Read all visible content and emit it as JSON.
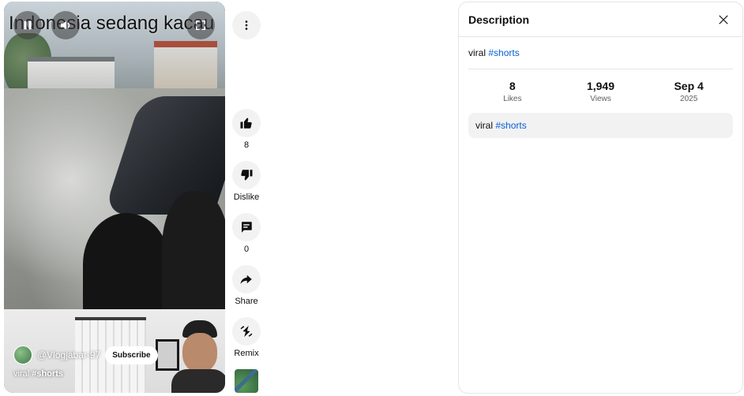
{
  "video": {
    "overlay_title": "Indonesia sedang kacau",
    "channel_name": "@Vlogjabar-97",
    "subscribe_label": "Subscribe",
    "caption_text": "viral",
    "caption_hashtag": "#shorts",
    "controls": [
      "pause-icon",
      "volume-icon",
      "fullscreen-icon"
    ]
  },
  "actions": {
    "more_icon": "more-vert-icon",
    "like": {
      "icon": "thumb-up-icon",
      "label": "8"
    },
    "dislike": {
      "icon": "thumb-down-icon",
      "label": "Dislike"
    },
    "comments": {
      "icon": "comment-icon",
      "label": "0"
    },
    "share": {
      "icon": "share-icon",
      "label": "Share"
    },
    "remix": {
      "icon": "remix-icon",
      "label": "Remix"
    }
  },
  "description_panel": {
    "title": "Description",
    "close_icon": "close-icon",
    "summary_text": "viral",
    "summary_hashtag": "#shorts",
    "stats": [
      {
        "value": "8",
        "label": "Likes"
      },
      {
        "value": "1,949",
        "label": "Views"
      },
      {
        "value": "Sep 4",
        "label": "2025"
      }
    ],
    "full_text": "viral",
    "full_hashtag": "#shorts"
  },
  "colors": {
    "hashtag": "#065fd4",
    "chip_bg": "#f2f2f2",
    "border": "#e5e5e5"
  }
}
